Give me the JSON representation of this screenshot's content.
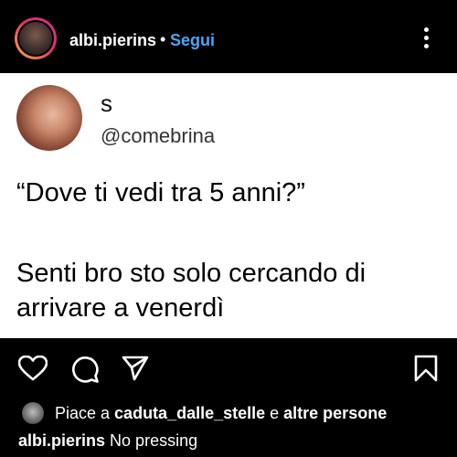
{
  "post": {
    "author": "albi.pierins",
    "separator": "•",
    "follow_label": "Segui",
    "more_icon": "more-vertical-icon"
  },
  "tweet": {
    "name": "s",
    "handle": "@comebrina",
    "line1": "“Dove ti vedi tra 5 anni?”",
    "line2": "Senti bro sto solo cercando di arrivare a venerdì"
  },
  "actions": {
    "icons": [
      "heart-icon",
      "comment-icon",
      "share-icon",
      "bookmark-icon"
    ]
  },
  "likes": {
    "prefix": "Piace a ",
    "user": "caduta_dalle_stelle",
    "middle": " e ",
    "others": "altre persone"
  },
  "caption": {
    "user": "albi.pierins",
    "text": "No pressing"
  },
  "colors": {
    "background": "#000000",
    "card": "#ffffff",
    "link": "#4fa3f7"
  }
}
